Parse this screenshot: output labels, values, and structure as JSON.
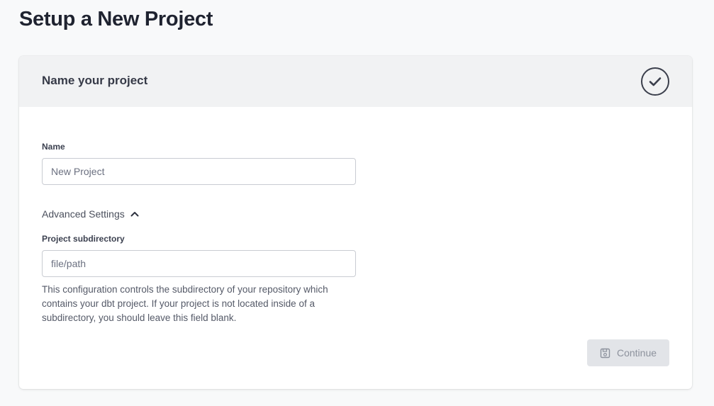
{
  "page": {
    "title": "Setup a New Project"
  },
  "card": {
    "title": "Name your project",
    "status_icon": "check-circle-icon"
  },
  "name_field": {
    "label": "Name",
    "value": "",
    "placeholder": "New Project"
  },
  "advanced": {
    "label": "Advanced Settings",
    "expanded": true,
    "icon": "chevron-up-icon"
  },
  "subdirectory_field": {
    "label": "Project subdirectory",
    "value": "",
    "placeholder": "file/path",
    "help": "This configuration controls the subdirectory of your repository which contains your dbt project. If your project is not located inside of a subdirectory, you should leave this field blank."
  },
  "continue_button": {
    "label": "Continue",
    "icon": "save-icon",
    "disabled": true
  }
}
